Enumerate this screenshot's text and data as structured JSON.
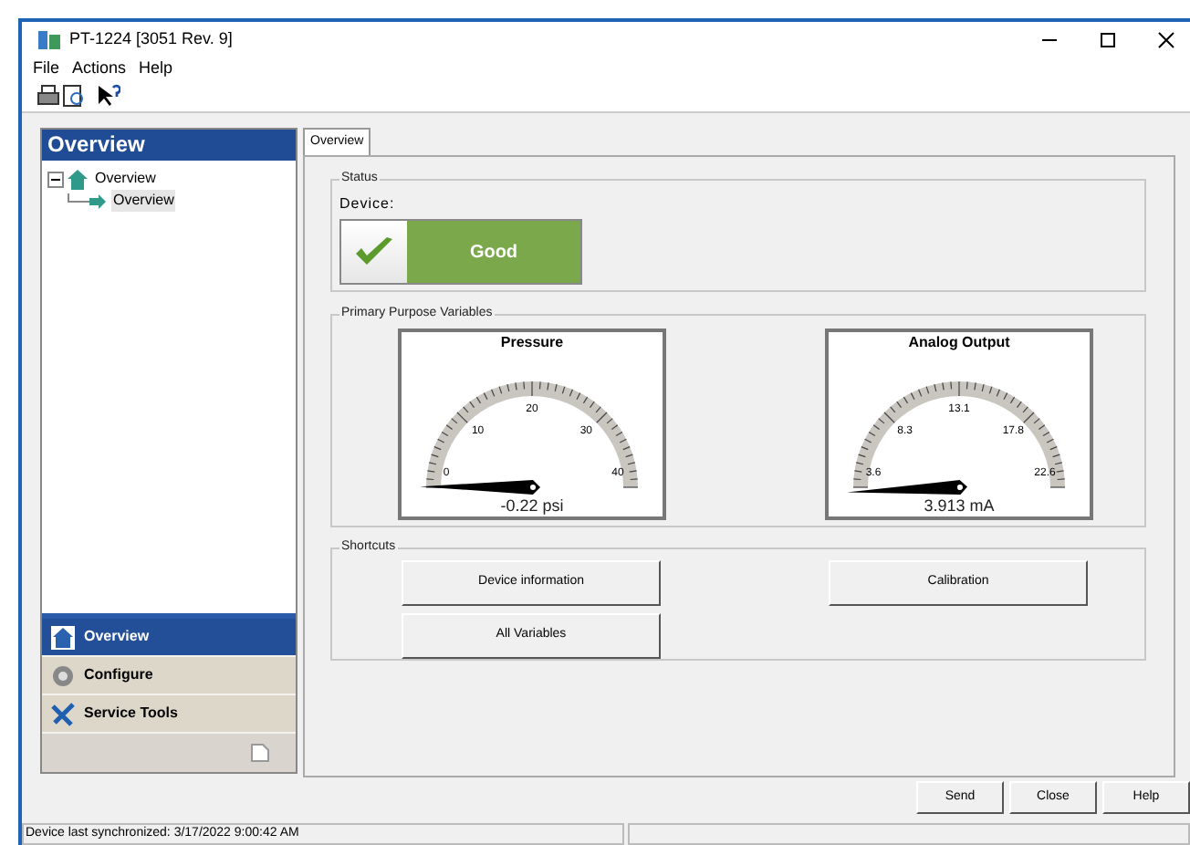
{
  "window": {
    "title": "PT-1224 [3051 Rev. 9]"
  },
  "menu": [
    "File",
    "Actions",
    "Help"
  ],
  "sidebar": {
    "title": "Overview",
    "tree": [
      {
        "label": "Overview",
        "expanded": true,
        "children": [
          {
            "label": "Overview",
            "selected": true
          }
        ]
      }
    ],
    "nav": [
      {
        "label": "Overview",
        "kind": "home",
        "selected": true
      },
      {
        "label": "Configure",
        "kind": "gear",
        "selected": false
      },
      {
        "label": "Service Tools",
        "kind": "tools",
        "selected": false
      }
    ]
  },
  "tabs": [
    {
      "label": "Overview",
      "selected": true
    }
  ],
  "status": {
    "group": "Status",
    "label": "Device:",
    "value": "Good"
  },
  "variables": {
    "group": "Primary Purpose Variables",
    "gauges": [
      {
        "title": "Pressure",
        "ticks": [
          "0",
          "10",
          "20",
          "30",
          "40"
        ],
        "reading": "-0.22 psi"
      },
      {
        "title": "Analog Output",
        "ticks": [
          "3.6",
          "8.3",
          "13.1",
          "17.8",
          "22.6"
        ],
        "reading": "3.913 mA"
      }
    ]
  },
  "shortcuts": {
    "group": "Shortcuts",
    "buttons": [
      "Device information",
      "Calibration",
      "All Variables"
    ]
  },
  "buttons": [
    "Send",
    "Close",
    "Help"
  ],
  "status_bar": "Device last synchronized: 3/17/2022 9:00:42 AM"
}
